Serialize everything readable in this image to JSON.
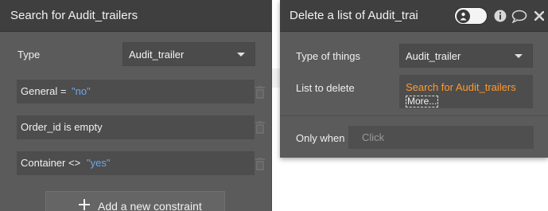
{
  "search_panel": {
    "title": "Search for Audit_trailers",
    "type_label": "Type",
    "type_value": "Audit_trailer",
    "constraints": [
      {
        "field": "General =",
        "value": "\"no\""
      },
      {
        "field": "Order_id is empty",
        "value": ""
      },
      {
        "field": "Container <>",
        "value": "\"yes\""
      }
    ],
    "add_constraint_label": "Add a new constraint"
  },
  "action_panel": {
    "title": "Delete a list of Audit_trai",
    "type_of_things_label": "Type of things",
    "type_of_things_value": "Audit_trailer",
    "list_to_delete_label": "List to delete",
    "list_to_delete_value": "Search for Audit_trailers",
    "more_label": "More...",
    "only_when_label": "Only when",
    "only_when_placeholder": "Click",
    "header_icons": [
      "toggle-switch",
      "info-icon",
      "comment-icon",
      "close-icon"
    ]
  },
  "colors": {
    "panel_bg": "#5b5b5b",
    "titlebar_bg": "#3f3f3f",
    "field_bg": "#4d4d4d",
    "string_literal": "#6aa7ee",
    "expression": "#ff9a2e"
  }
}
